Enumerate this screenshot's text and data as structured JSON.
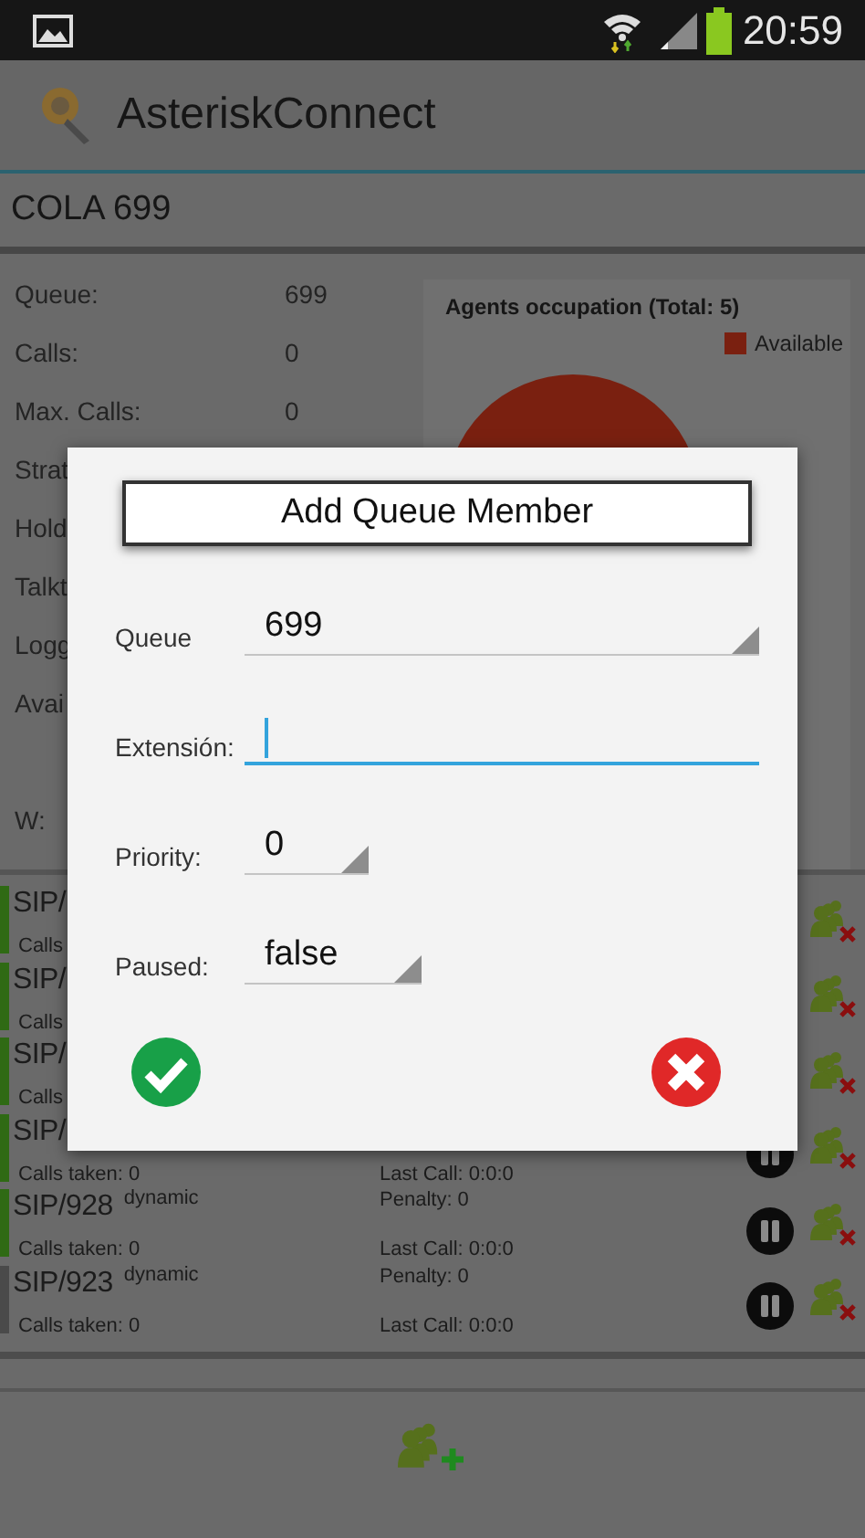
{
  "status_bar": {
    "time": "20:59"
  },
  "app_bar": {
    "title": "AsteriskConnect"
  },
  "queue_header": {
    "title": "COLA 699"
  },
  "queue_info": {
    "rows": [
      {
        "label": "Queue:",
        "value": "699"
      },
      {
        "label": "Calls:",
        "value": "0"
      },
      {
        "label": "Max. Calls:",
        "value": "0"
      },
      {
        "label": "Strat"
      },
      {
        "label": "Hold"
      },
      {
        "label": "Talkt"
      },
      {
        "label": "Logg"
      },
      {
        "label": "Avai"
      }
    ],
    "footer": "W:"
  },
  "chart": {
    "title": "Agents occupation (Total: 5)",
    "legend": [
      {
        "label": "Available",
        "color": "#7a2010"
      }
    ]
  },
  "members": [
    {
      "name": "SIP/",
      "calls_taken": "Calls",
      "color": "#2f6a14"
    },
    {
      "name": "SIP/",
      "calls_taken": "Calls",
      "color": "#2f6a14"
    },
    {
      "name": "SIP/",
      "calls_taken": "Calls",
      "color": "#2f6a14"
    },
    {
      "name": "SIP/",
      "calls_taken": "Calls taken: 0",
      "last_call": "Last Call: 0:0:0",
      "color": "#2f6a14",
      "pause_button": true
    },
    {
      "name": "SIP/928",
      "type": "dynamic",
      "penalty": "Penalty: 0",
      "calls_taken": "Calls taken: 0",
      "last_call": "Last Call: 0:0:0",
      "color": "#2f6a14",
      "pause_button": true
    },
    {
      "name": "SIP/923",
      "type": "dynamic",
      "penalty": "Penalty: 0",
      "calls_taken": "Calls taken: 0",
      "last_call": "Last Call: 0:0:0",
      "color": "#4a4a4a",
      "pause_button": true
    }
  ],
  "dialog": {
    "title": "Add Queue Member",
    "fields": [
      {
        "kind": "dropdown",
        "label": "Queue",
        "value": "699"
      },
      {
        "kind": "text",
        "label": "Extensión:",
        "focused": true
      },
      {
        "kind": "dropdown",
        "label": "Priority:",
        "value": "0"
      },
      {
        "kind": "dropdown",
        "label": "Paused:",
        "value": "false"
      }
    ]
  }
}
